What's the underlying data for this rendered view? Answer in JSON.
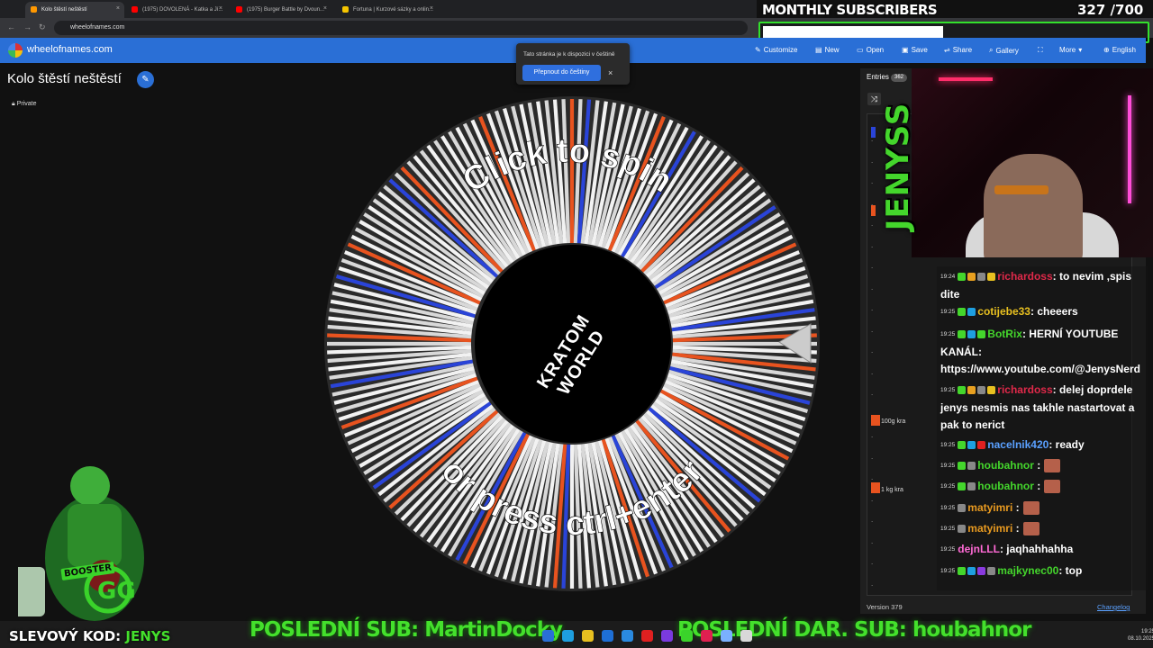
{
  "browser": {
    "tabs": [
      {
        "label": "Kolo štěstí neštěstí",
        "active": true,
        "color": "#ff9800"
      },
      {
        "label": "(1975) DOVOLENÁ - Katka a Jí...",
        "active": false,
        "color": "#ff0000"
      },
      {
        "label": "(1975) Burger Battle by Dvoun...",
        "active": false,
        "color": "#ff0000"
      },
      {
        "label": "Fortuna | Kurzové sázky a onlin...",
        "active": false,
        "color": "#f5c400"
      }
    ],
    "url": "wheelofnames.com"
  },
  "overlay": {
    "subs_title": "MONTHLY SUBSCRIBERS",
    "subs_count": "327 /700",
    "subs_progress": 0.467
  },
  "site": {
    "name": "wheelofnames.com",
    "menu": [
      {
        "icon": "palette-icon",
        "glyph": "✎",
        "label": "Customize"
      },
      {
        "icon": "new-file-icon",
        "glyph": "▤",
        "label": "New"
      },
      {
        "icon": "folder-icon",
        "glyph": "▭",
        "label": "Open"
      },
      {
        "icon": "save-icon",
        "glyph": "▣",
        "label": "Save"
      },
      {
        "icon": "share-icon",
        "glyph": "⇌",
        "label": "Share"
      },
      {
        "icon": "search-icon",
        "glyph": "⌕",
        "label": "Gallery"
      },
      {
        "icon": "fullscreen-icon",
        "glyph": "⛶",
        "label": ""
      },
      {
        "icon": "chevron-down-icon",
        "glyph": "▾",
        "label": "More"
      },
      {
        "icon": "globe-icon",
        "glyph": "⊕",
        "label": "English"
      }
    ]
  },
  "popup": {
    "text": "Tato stránka je k dispozici v češtině",
    "button": "Přepnout do češtiny",
    "close": "×"
  },
  "page": {
    "title": "Kolo štěstí neštěstí",
    "private_label": "Private"
  },
  "wheel": {
    "top_text": "Click to spin",
    "bottom_text": "or press ctrl+enter",
    "hub_text": "KRATOM WORLD",
    "colors": {
      "base": "#d8d8d8",
      "orange": "#e8531f",
      "blue": "#2a44d8",
      "dark": "#2a2a2a"
    }
  },
  "entries": {
    "tab_label": "Entries",
    "count": "362",
    "visible": [
      {
        "text": "100g kra"
      },
      {
        "text": "1 kg kra"
      }
    ],
    "version": "Version 379",
    "changelog": "Changelog"
  },
  "streamer": {
    "name": "JENYSS"
  },
  "chat": [
    {
      "time": "19:24",
      "user": "richardoss",
      "color": "#e0294a",
      "msg": ": to nevim ,spis dite",
      "badges": [
        "#44d62c",
        "#e8a020",
        "#888",
        "#e8c020"
      ],
      "emote": false
    },
    {
      "time": "19:25",
      "user": "cotijebe33",
      "color": "#e8c020",
      "msg": ": cheeers",
      "badges": [
        "#44d62c",
        "#1e9fe0"
      ],
      "emote": false
    },
    {
      "time": "19:25",
      "user": "BotRix",
      "color": "#44d62c",
      "msg": ": HERNÍ YOUTUBE KANÁL: https://www.youtube.com/@JenysNerd",
      "badges": [
        "#44d62c",
        "#1e9fe0",
        "#44d62c"
      ],
      "emote": false
    },
    {
      "time": "19:25",
      "user": "richardoss",
      "color": "#e0294a",
      "msg": ": delej doprdele jenys nesmis nas takhle nastartovat a pak to nerict",
      "badges": [
        "#44d62c",
        "#e8a020",
        "#888",
        "#e8c020"
      ],
      "emote": false
    },
    {
      "time": "19:25",
      "user": "nacelnik420",
      "color": "#5aa0ff",
      "msg": ": ready",
      "badges": [
        "#44d62c",
        "#1e9fe0",
        "#e02020"
      ],
      "emote": false
    },
    {
      "time": "19:25",
      "user": "houbahnor",
      "color": "#44d62c",
      "msg": " :",
      "badges": [
        "#44d62c",
        "#888"
      ],
      "emote": true
    },
    {
      "time": "19:25",
      "user": "houbahnor",
      "color": "#44d62c",
      "msg": " :",
      "badges": [
        "#44d62c",
        "#888"
      ],
      "emote": true
    },
    {
      "time": "19:25",
      "user": "matyimri",
      "color": "#e89a20",
      "msg": " :",
      "badges": [
        "#888"
      ],
      "emote": true
    },
    {
      "time": "19:25",
      "user": "matyimri",
      "color": "#e89a20",
      "msg": " :",
      "badges": [
        "#888"
      ],
      "emote": true
    },
    {
      "time": "19:25",
      "user": "dejnLLL",
      "color": "#ff6ad5",
      "msg": ": jaqhahhahha",
      "badges": [],
      "emote": false
    },
    {
      "time": "19:25",
      "user": "majkynec00",
      "color": "#44d62c",
      "msg": ": top",
      "badges": [
        "#44d62c",
        "#1e9fe0",
        "#8a3adf",
        "#888"
      ],
      "emote": false
    }
  ],
  "bottom": {
    "discount_label": "SLEVOVÝ KOD:",
    "discount_code": "JENYS",
    "last_sub": "POSLEDNÍ SUB: MartinDocky",
    "last_gift_sub": "POSLEDNÍ DAR. SUB: houbahnor",
    "booster": "BOOSTER",
    "clock_time": "19:25",
    "clock_date": "08.10.2025"
  }
}
